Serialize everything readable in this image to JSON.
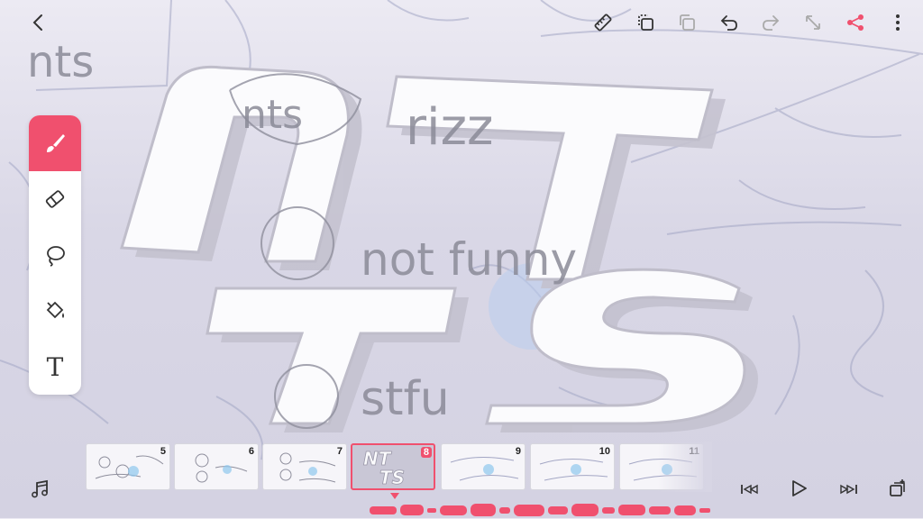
{
  "canvas": {
    "handwriting": [
      "nts",
      "rizz",
      "not funny",
      "stfu"
    ],
    "logo_text_top": "NT",
    "logo_text_bottom": "TS"
  },
  "toolbar": {
    "icons": [
      "back-icon",
      "ruler-icon",
      "layer-copy-icon",
      "layer-icon",
      "undo-icon",
      "redo-icon",
      "expand-icon",
      "share-icon",
      "more-icon"
    ],
    "accent": "#f0506e"
  },
  "tools": {
    "items": [
      "brush",
      "eraser",
      "lasso",
      "fill",
      "text"
    ],
    "active": "brush",
    "text_label": "T"
  },
  "timeline": {
    "frames": [
      {
        "num": "5"
      },
      {
        "num": "6"
      },
      {
        "num": "7"
      },
      {
        "num": "8"
      },
      {
        "num": "9"
      },
      {
        "num": "10"
      },
      {
        "num": "11"
      }
    ],
    "selected_frame": "8",
    "thumb_top": "NT",
    "thumb_bottom": "TS"
  }
}
